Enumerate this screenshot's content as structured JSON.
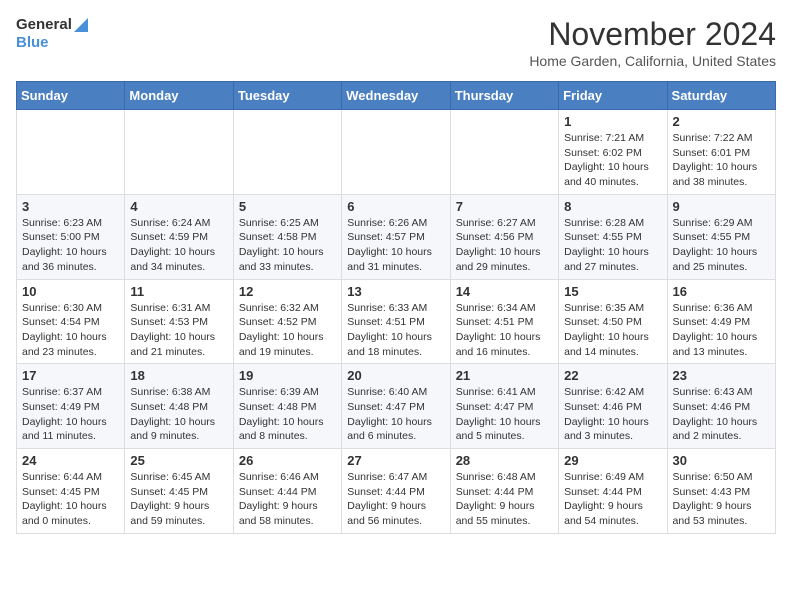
{
  "logo": {
    "line1": "General",
    "line2": "Blue"
  },
  "title": "November 2024",
  "location": "Home Garden, California, United States",
  "weekdays": [
    "Sunday",
    "Monday",
    "Tuesday",
    "Wednesday",
    "Thursday",
    "Friday",
    "Saturday"
  ],
  "weeks": [
    [
      {
        "day": "",
        "info": ""
      },
      {
        "day": "",
        "info": ""
      },
      {
        "day": "",
        "info": ""
      },
      {
        "day": "",
        "info": ""
      },
      {
        "day": "",
        "info": ""
      },
      {
        "day": "1",
        "info": "Sunrise: 7:21 AM\nSunset: 6:02 PM\nDaylight: 10 hours\nand 40 minutes."
      },
      {
        "day": "2",
        "info": "Sunrise: 7:22 AM\nSunset: 6:01 PM\nDaylight: 10 hours\nand 38 minutes."
      }
    ],
    [
      {
        "day": "3",
        "info": "Sunrise: 6:23 AM\nSunset: 5:00 PM\nDaylight: 10 hours\nand 36 minutes."
      },
      {
        "day": "4",
        "info": "Sunrise: 6:24 AM\nSunset: 4:59 PM\nDaylight: 10 hours\nand 34 minutes."
      },
      {
        "day": "5",
        "info": "Sunrise: 6:25 AM\nSunset: 4:58 PM\nDaylight: 10 hours\nand 33 minutes."
      },
      {
        "day": "6",
        "info": "Sunrise: 6:26 AM\nSunset: 4:57 PM\nDaylight: 10 hours\nand 31 minutes."
      },
      {
        "day": "7",
        "info": "Sunrise: 6:27 AM\nSunset: 4:56 PM\nDaylight: 10 hours\nand 29 minutes."
      },
      {
        "day": "8",
        "info": "Sunrise: 6:28 AM\nSunset: 4:55 PM\nDaylight: 10 hours\nand 27 minutes."
      },
      {
        "day": "9",
        "info": "Sunrise: 6:29 AM\nSunset: 4:55 PM\nDaylight: 10 hours\nand 25 minutes."
      }
    ],
    [
      {
        "day": "10",
        "info": "Sunrise: 6:30 AM\nSunset: 4:54 PM\nDaylight: 10 hours\nand 23 minutes."
      },
      {
        "day": "11",
        "info": "Sunrise: 6:31 AM\nSunset: 4:53 PM\nDaylight: 10 hours\nand 21 minutes."
      },
      {
        "day": "12",
        "info": "Sunrise: 6:32 AM\nSunset: 4:52 PM\nDaylight: 10 hours\nand 19 minutes."
      },
      {
        "day": "13",
        "info": "Sunrise: 6:33 AM\nSunset: 4:51 PM\nDaylight: 10 hours\nand 18 minutes."
      },
      {
        "day": "14",
        "info": "Sunrise: 6:34 AM\nSunset: 4:51 PM\nDaylight: 10 hours\nand 16 minutes."
      },
      {
        "day": "15",
        "info": "Sunrise: 6:35 AM\nSunset: 4:50 PM\nDaylight: 10 hours\nand 14 minutes."
      },
      {
        "day": "16",
        "info": "Sunrise: 6:36 AM\nSunset: 4:49 PM\nDaylight: 10 hours\nand 13 minutes."
      }
    ],
    [
      {
        "day": "17",
        "info": "Sunrise: 6:37 AM\nSunset: 4:49 PM\nDaylight: 10 hours\nand 11 minutes."
      },
      {
        "day": "18",
        "info": "Sunrise: 6:38 AM\nSunset: 4:48 PM\nDaylight: 10 hours\nand 9 minutes."
      },
      {
        "day": "19",
        "info": "Sunrise: 6:39 AM\nSunset: 4:48 PM\nDaylight: 10 hours\nand 8 minutes."
      },
      {
        "day": "20",
        "info": "Sunrise: 6:40 AM\nSunset: 4:47 PM\nDaylight: 10 hours\nand 6 minutes."
      },
      {
        "day": "21",
        "info": "Sunrise: 6:41 AM\nSunset: 4:47 PM\nDaylight: 10 hours\nand 5 minutes."
      },
      {
        "day": "22",
        "info": "Sunrise: 6:42 AM\nSunset: 4:46 PM\nDaylight: 10 hours\nand 3 minutes."
      },
      {
        "day": "23",
        "info": "Sunrise: 6:43 AM\nSunset: 4:46 PM\nDaylight: 10 hours\nand 2 minutes."
      }
    ],
    [
      {
        "day": "24",
        "info": "Sunrise: 6:44 AM\nSunset: 4:45 PM\nDaylight: 10 hours\nand 0 minutes."
      },
      {
        "day": "25",
        "info": "Sunrise: 6:45 AM\nSunset: 4:45 PM\nDaylight: 9 hours\nand 59 minutes."
      },
      {
        "day": "26",
        "info": "Sunrise: 6:46 AM\nSunset: 4:44 PM\nDaylight: 9 hours\nand 58 minutes."
      },
      {
        "day": "27",
        "info": "Sunrise: 6:47 AM\nSunset: 4:44 PM\nDaylight: 9 hours\nand 56 minutes."
      },
      {
        "day": "28",
        "info": "Sunrise: 6:48 AM\nSunset: 4:44 PM\nDaylight: 9 hours\nand 55 minutes."
      },
      {
        "day": "29",
        "info": "Sunrise: 6:49 AM\nSunset: 4:44 PM\nDaylight: 9 hours\nand 54 minutes."
      },
      {
        "day": "30",
        "info": "Sunrise: 6:50 AM\nSunset: 4:43 PM\nDaylight: 9 hours\nand 53 minutes."
      }
    ]
  ]
}
